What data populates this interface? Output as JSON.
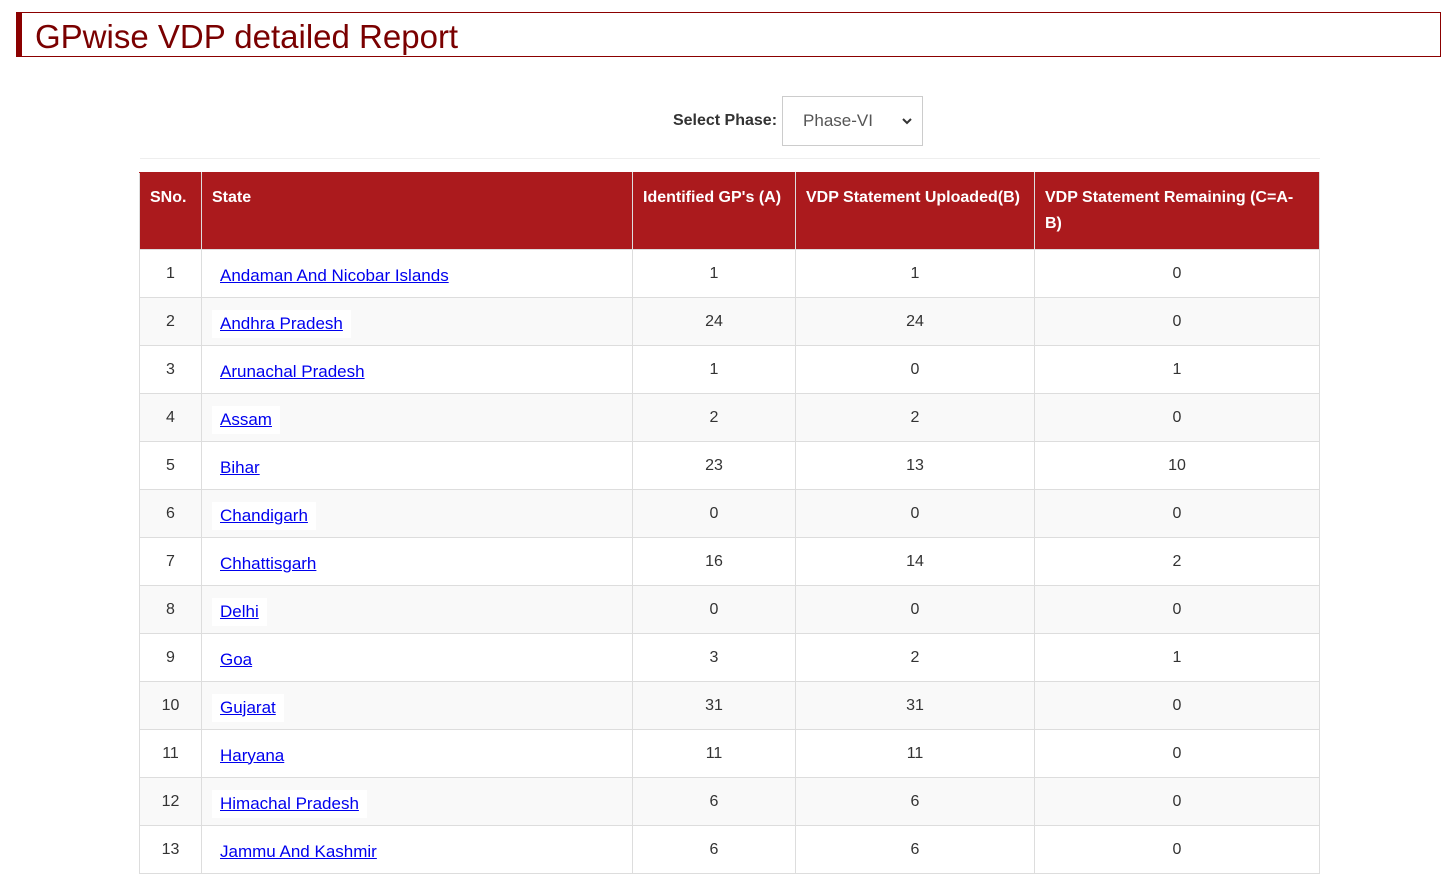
{
  "header": {
    "title": "GPwise VDP detailed Report"
  },
  "filter": {
    "label": "Select Phase:",
    "selected": "Phase-VI"
  },
  "table": {
    "columns": [
      "SNo.",
      "State",
      "Identified GP's (A)",
      "VDP Statement Uploaded(B)",
      "VDP Statement Remaining (C=A-B)"
    ],
    "rows": [
      {
        "sno": "1",
        "state": "Andaman And Nicobar Islands",
        "a": "1",
        "b": "1",
        "c": "0"
      },
      {
        "sno": "2",
        "state": "Andhra Pradesh",
        "a": "24",
        "b": "24",
        "c": "0"
      },
      {
        "sno": "3",
        "state": "Arunachal Pradesh",
        "a": "1",
        "b": "0",
        "c": "1"
      },
      {
        "sno": "4",
        "state": "Assam",
        "a": "2",
        "b": "2",
        "c": "0"
      },
      {
        "sno": "5",
        "state": "Bihar",
        "a": "23",
        "b": "13",
        "c": "10"
      },
      {
        "sno": "6",
        "state": "Chandigarh",
        "a": "0",
        "b": "0",
        "c": "0"
      },
      {
        "sno": "7",
        "state": "Chhattisgarh",
        "a": "16",
        "b": "14",
        "c": "2"
      },
      {
        "sno": "8",
        "state": "Delhi",
        "a": "0",
        "b": "0",
        "c": "0"
      },
      {
        "sno": "9",
        "state": "Goa",
        "a": "3",
        "b": "2",
        "c": "1"
      },
      {
        "sno": "10",
        "state": "Gujarat",
        "a": "31",
        "b": "31",
        "c": "0"
      },
      {
        "sno": "11",
        "state": "Haryana",
        "a": "11",
        "b": "11",
        "c": "0"
      },
      {
        "sno": "12",
        "state": "Himachal Pradesh",
        "a": "6",
        "b": "6",
        "c": "0"
      },
      {
        "sno": "13",
        "state": "Jammu And Kashmir",
        "a": "6",
        "b": "6",
        "c": "0"
      }
    ]
  },
  "colors": {
    "header_bg": "#ab1a1d",
    "title": "#7a0000",
    "link": "#0000ee"
  }
}
